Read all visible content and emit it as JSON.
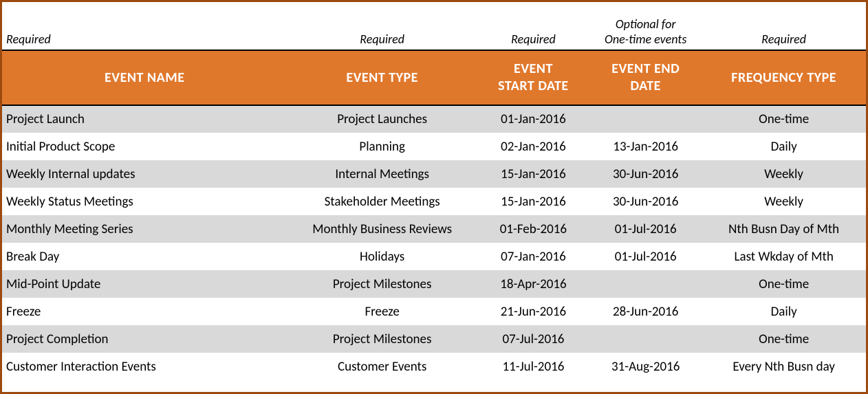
{
  "hints": {
    "event_name": "Required",
    "event_type": "Required",
    "start_date": "Required",
    "end_date_line1": "Optional for",
    "end_date_line2": "One-time events",
    "frequency": "Required"
  },
  "headers": {
    "event_name": "EVENT NAME",
    "event_type": "EVENT TYPE",
    "start_date_l1": "EVENT",
    "start_date_l2": "START DATE",
    "end_date_l1": "EVENT END",
    "end_date_l2": "DATE",
    "frequency": "FREQUENCY TYPE"
  },
  "rows": [
    {
      "name": "Project Launch",
      "type": "Project Launches",
      "start": "01-Jan-2016",
      "end": "",
      "freq": "One-time"
    },
    {
      "name": "Initial Product Scope",
      "type": "Planning",
      "start": "02-Jan-2016",
      "end": "13-Jan-2016",
      "freq": "Daily"
    },
    {
      "name": "Weekly Internal updates",
      "type": "Internal Meetings",
      "start": "15-Jan-2016",
      "end": "30-Jun-2016",
      "freq": "Weekly"
    },
    {
      "name": "Weekly Status Meetings",
      "type": "Stakeholder Meetings",
      "start": "15-Jan-2016",
      "end": "30-Jun-2016",
      "freq": "Weekly"
    },
    {
      "name": "Monthly Meeting Series",
      "type": "Monthly Business Reviews",
      "start": "01-Feb-2016",
      "end": "01-Jul-2016",
      "freq": "Nth Busn Day of Mth"
    },
    {
      "name": "Break Day",
      "type": "Holidays",
      "start": "07-Jan-2016",
      "end": "01-Jul-2016",
      "freq": "Last Wkday of Mth"
    },
    {
      "name": "Mid-Point Update",
      "type": "Project Milestones",
      "start": "18-Apr-2016",
      "end": "",
      "freq": "One-time"
    },
    {
      "name": "Freeze",
      "type": "Freeze",
      "start": "21-Jun-2016",
      "end": "28-Jun-2016",
      "freq": "Daily"
    },
    {
      "name": "Project Completion",
      "type": "Project Milestones",
      "start": "07-Jul-2016",
      "end": "",
      "freq": "One-time"
    },
    {
      "name": "Customer Interaction Events",
      "type": "Customer Events",
      "start": "11-Jul-2016",
      "end": "31-Aug-2016",
      "freq": "Every Nth Busn day"
    }
  ]
}
